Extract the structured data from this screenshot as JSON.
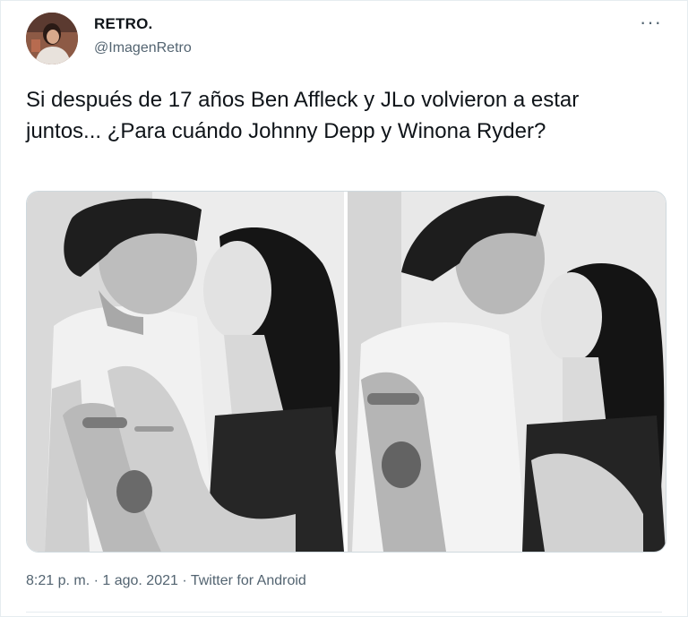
{
  "author": {
    "display_name": "RETRO.",
    "handle": "@ImagenRetro"
  },
  "tweet": {
    "text": "Si después de 17 años Ben Affleck y JLo volvieron a estar juntos... ¿Para cuándo Johnny Depp y Winona Ryder?"
  },
  "more_menu": {
    "glyph": "···"
  },
  "meta": {
    "time": "8:21 p. m.",
    "separator": " · ",
    "date": "1 ago. 2021",
    "source": "Twitter for Android"
  },
  "colors": {
    "text": "#0f1419",
    "secondary": "#536471",
    "border": "#cfd9de"
  }
}
